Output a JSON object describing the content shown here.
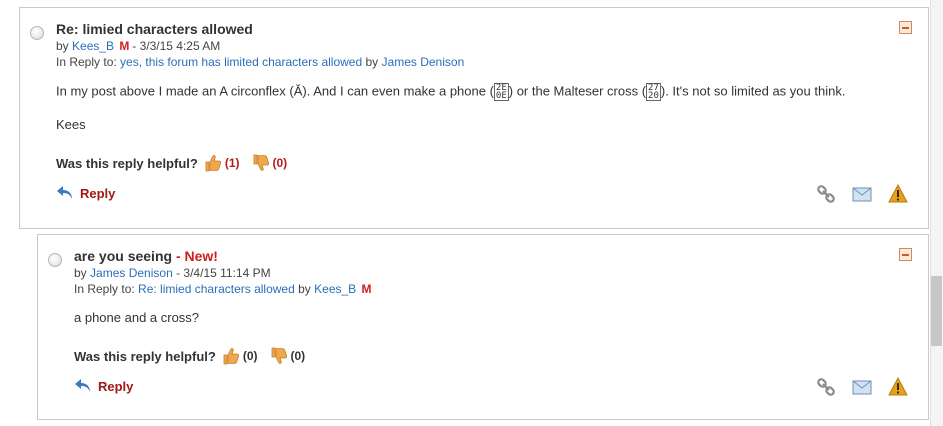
{
  "posts": [
    {
      "title": "Re: limied characters allowed",
      "new_label": "",
      "by_prefix": "by",
      "author": "Kees_B",
      "author_badge": "M",
      "timestamp": "- 3/3/15 4:25 AM",
      "in_reply_prefix": "In Reply to:",
      "in_reply_link": "yes, this forum has limited characters allowed",
      "in_reply_by": "by",
      "in_reply_author": "James Denison",
      "in_reply_author_badge": "",
      "body_paragraphs": [
        "In my post above I made an A circonflex (Ă). And I can even make a phone (",
        ") or the Malteser cross (",
        "). It's not so limited as you think."
      ],
      "glyph_phone": "2E\n0E",
      "glyph_cross": "27\n20",
      "signature": "Kees",
      "helpful_label": "Was this reply helpful?",
      "yes_count": "(1)",
      "no_count": "(0)",
      "reply_label": "Reply"
    },
    {
      "title": "are you seeing",
      "new_label": "- New!",
      "by_prefix": "by",
      "author": "James Denison",
      "author_badge": "",
      "timestamp": "- 3/4/15 11:14 PM",
      "in_reply_prefix": "In Reply to:",
      "in_reply_link": "Re: limied characters allowed",
      "in_reply_by": "by",
      "in_reply_author": "Kees_B",
      "in_reply_author_badge": "M",
      "body": "a phone and a cross?",
      "helpful_label": "Was this reply helpful?",
      "yes_count": "(0)",
      "no_count": "(0)",
      "reply_label": "Reply"
    }
  ],
  "icons": {
    "thumbs_up": "thumbs-up-icon",
    "thumbs_down": "thumbs-down-icon",
    "reply": "reply-arrow-icon",
    "link": "chain-link-icon",
    "email": "envelope-icon",
    "report": "warning-triangle-icon"
  },
  "colors": {
    "link": "#2a6ebb",
    "reply": "#a01818",
    "new_badge": "#cc1f1f",
    "yes_count": "#b31b1b",
    "thumb": "#f0a94a",
    "warning": "#e6a01d"
  }
}
